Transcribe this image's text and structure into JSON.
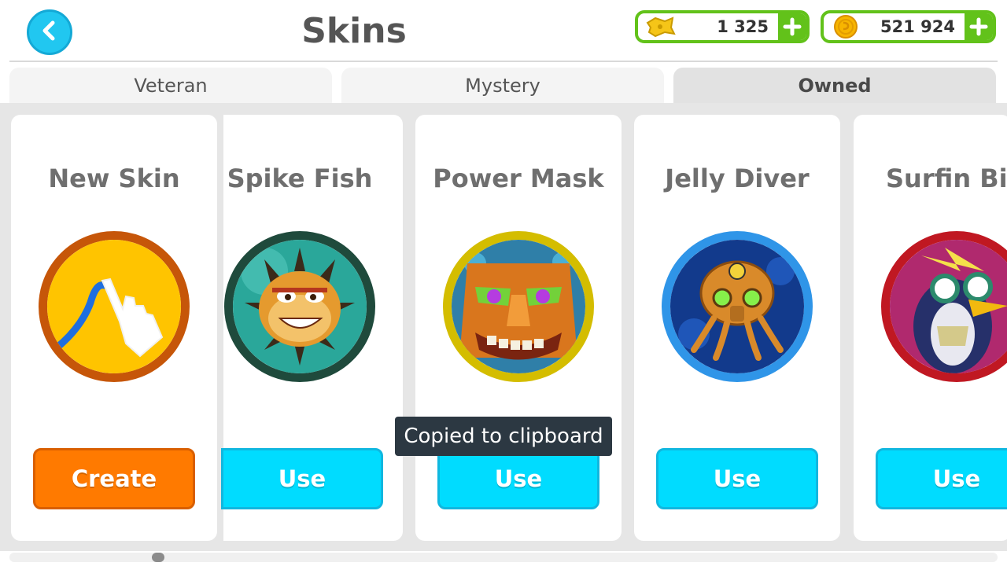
{
  "header": {
    "title": "Skins",
    "back_icon": "chevron-left-icon",
    "currencies": [
      {
        "name": "tickets",
        "icon": "ticket-icon",
        "amount": "1 325"
      },
      {
        "name": "coins",
        "icon": "coin-icon",
        "amount": "521 924"
      }
    ],
    "accent_color": "#62c21a"
  },
  "tabs": [
    {
      "label": "Veteran",
      "selected": false
    },
    {
      "label": "Mystery",
      "selected": false
    },
    {
      "label": "Owned",
      "selected": true
    }
  ],
  "cards": [
    {
      "title": "New Skin",
      "button": "Create",
      "ring_color": "#c65609"
    },
    {
      "title": "Spike Fish",
      "button": "Use",
      "ring_color": "#1f4a3c"
    },
    {
      "title": "Power Mask",
      "button": "Use",
      "ring_color": "#d4bd00"
    },
    {
      "title": "Jelly Diver",
      "button": "Use",
      "ring_color": "#2f95e8"
    },
    {
      "title": "Surfin Bird",
      "button": "Use",
      "ring_color": "#c01822"
    }
  ],
  "toast": {
    "text": "Copied to clipboard"
  },
  "colors": {
    "use_button": "#00dcff",
    "create_button": "#ff7a00",
    "back_button": "#21c7f0"
  }
}
